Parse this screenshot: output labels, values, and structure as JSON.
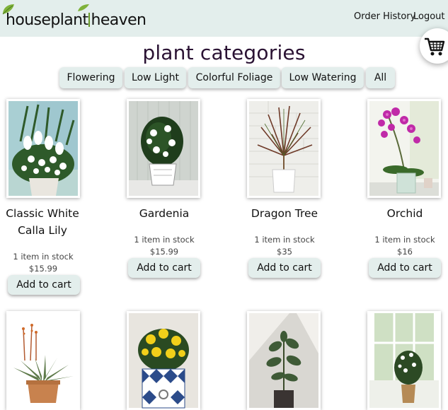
{
  "header": {
    "brand_part1": "houseplant",
    "brand_part2": "heaven",
    "order_history": "Order History",
    "logout": "Logout",
    "cart_icon": "shopping-cart-icon"
  },
  "page_title": "plant categories",
  "categories": [
    "Flowering",
    "Low Light",
    "Colorful Foliage",
    "Low Watering",
    "All"
  ],
  "products": [
    {
      "name_line1": "Classic White",
      "name_line2": "Calla  Lily",
      "stock": "1 item in stock",
      "price": "$15.99",
      "button": "Add to cart"
    },
    {
      "name_line1": "Gardenia",
      "name_line2": "",
      "stock": "1 item in stock",
      "price": "$15.99",
      "button": "Add to cart"
    },
    {
      "name_line1": "Dragon Tree",
      "name_line2": "",
      "stock": "1 item in stock",
      "price": "$35",
      "button": "Add to cart"
    },
    {
      "name_line1": "Orchid",
      "name_line2": "",
      "stock": "1 item in stock",
      "price": "$16",
      "button": "Add to cart"
    }
  ],
  "colors": {
    "header_bg": "#e3eeec",
    "button_bg": "#e3eeec",
    "title": "#2a1233"
  }
}
